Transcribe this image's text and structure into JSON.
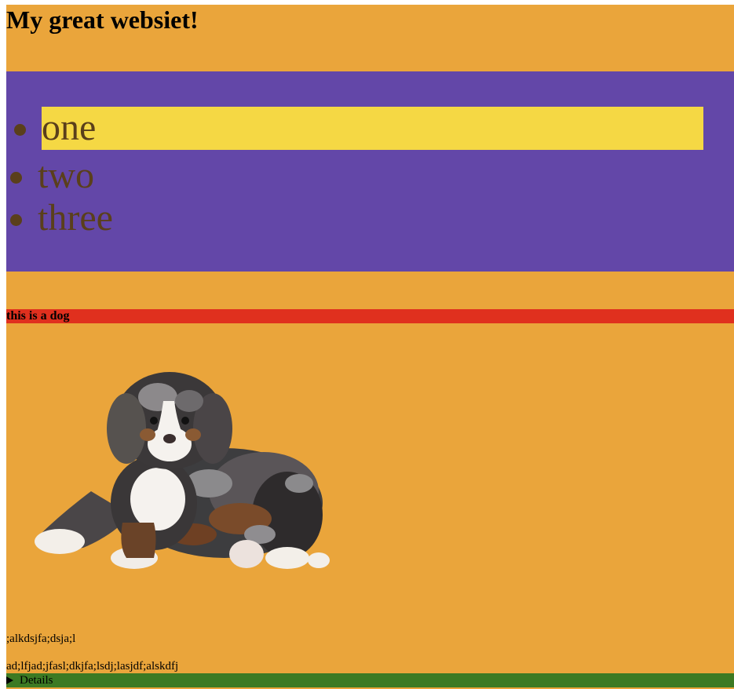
{
  "header": {
    "title": "My great websiet!"
  },
  "nav": {
    "items": [
      {
        "label": "one",
        "active": true
      },
      {
        "label": "two",
        "active": false
      },
      {
        "label": "three",
        "active": false
      }
    ]
  },
  "figure": {
    "caption": "this is a dog",
    "image": "puppy-photo"
  },
  "content": {
    "paragraphs": [
      ";alkdsjfa;dsja;l",
      "ad;lfjad;jfasl;dkjfa;lsdj;lasjdf;alskdfj"
    ]
  },
  "details": {
    "summary_label": "Details",
    "expanded": false
  },
  "colors": {
    "page_background": "#eaa53b",
    "nav_background": "#6347a8",
    "active_item_background": "#f5d844",
    "nav_text": "#5a3f1b",
    "caption_bar": "#e0301e",
    "details_bar": "#3c7a23"
  }
}
